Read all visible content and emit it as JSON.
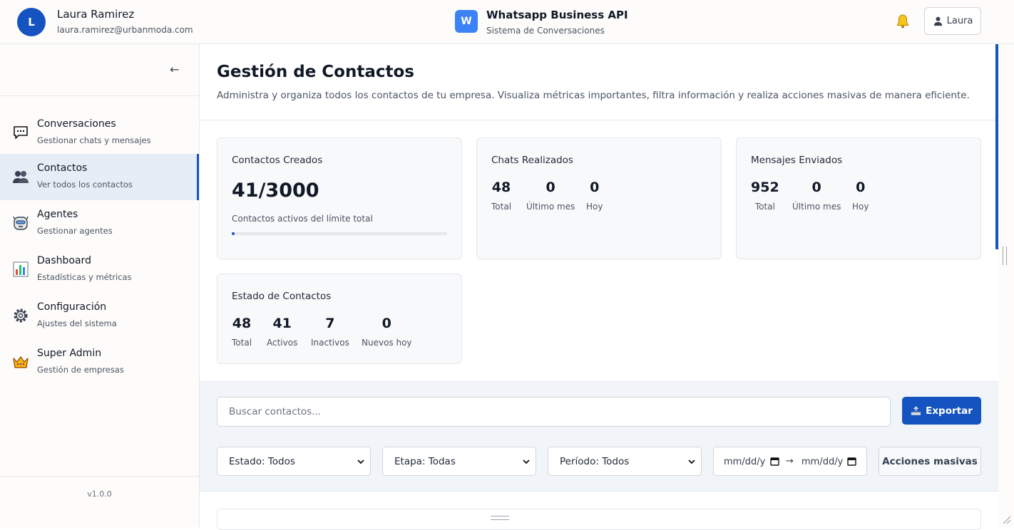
{
  "header": {
    "user_initial": "L",
    "user_name": "Laura Ramirez",
    "user_email": "laura.ramirez@urbanmoda.com",
    "app_initial": "W",
    "app_title": "Whatsapp Business API",
    "app_subtitle": "Sistema de Conversaciones",
    "account_label": "Laura"
  },
  "sidebar": {
    "collapse_symbol": "←",
    "items": [
      {
        "title": "Conversaciones",
        "subtitle": "Gestionar chats y mensajes",
        "icon": "chat-bubble-icon"
      },
      {
        "title": "Contactos",
        "subtitle": "Ver todos los contactos",
        "icon": "people-icon",
        "active": true
      },
      {
        "title": "Agentes",
        "subtitle": "Gestionar agentes",
        "icon": "robot-agent-icon"
      },
      {
        "title": "Dashboard",
        "subtitle": "Estadísticas y métricas",
        "icon": "bar-chart-icon"
      },
      {
        "title": "Configuración",
        "subtitle": "Ajustes del sistema",
        "icon": "gear-icon"
      },
      {
        "title": "Super Admin",
        "subtitle": "Gestión de empresas",
        "icon": "crown-icon"
      }
    ],
    "version": "v1.0.0"
  },
  "page": {
    "title": "Gestión de Contactos",
    "description": "Administra y organiza todos los contactos de tu empresa. Visualiza métricas importantes, filtra información y realiza acciones masivas de manera eficiente."
  },
  "cards": {
    "created": {
      "title": "Contactos Creados",
      "value": "41/3000",
      "caption": "Contactos activos del límite total",
      "progress_fraction": 0.0137
    },
    "chats": {
      "title": "Chats Realizados",
      "stats": [
        {
          "value": "48",
          "label": "Total"
        },
        {
          "value": "0",
          "label": "Último mes"
        },
        {
          "value": "0",
          "label": "Hoy"
        }
      ]
    },
    "messages": {
      "title": "Mensajes Enviados",
      "stats": [
        {
          "value": "952",
          "label": "Total"
        },
        {
          "value": "0",
          "label": "Último mes"
        },
        {
          "value": "0",
          "label": "Hoy"
        }
      ]
    },
    "status": {
      "title": "Estado de Contactos",
      "stats": [
        {
          "value": "48",
          "label": "Total"
        },
        {
          "value": "41",
          "label": "Activos"
        },
        {
          "value": "7",
          "label": "Inactivos"
        },
        {
          "value": "0",
          "label": "Nuevos hoy"
        }
      ]
    }
  },
  "filters": {
    "search_placeholder": "Buscar contactos...",
    "export_label": "Exportar",
    "estado": "Estado: Todos",
    "etapa": "Etapa: Todas",
    "periodo": "Período: Todos",
    "date_from": "mm/dd/y",
    "date_to": "mm/dd/y",
    "date_separator": "→",
    "bulk_label": "Acciones masivas"
  },
  "colors": {
    "primary": "#1554c0",
    "app_logo": "#3b82f6",
    "active_nav_bg": "#e6edf7"
  }
}
